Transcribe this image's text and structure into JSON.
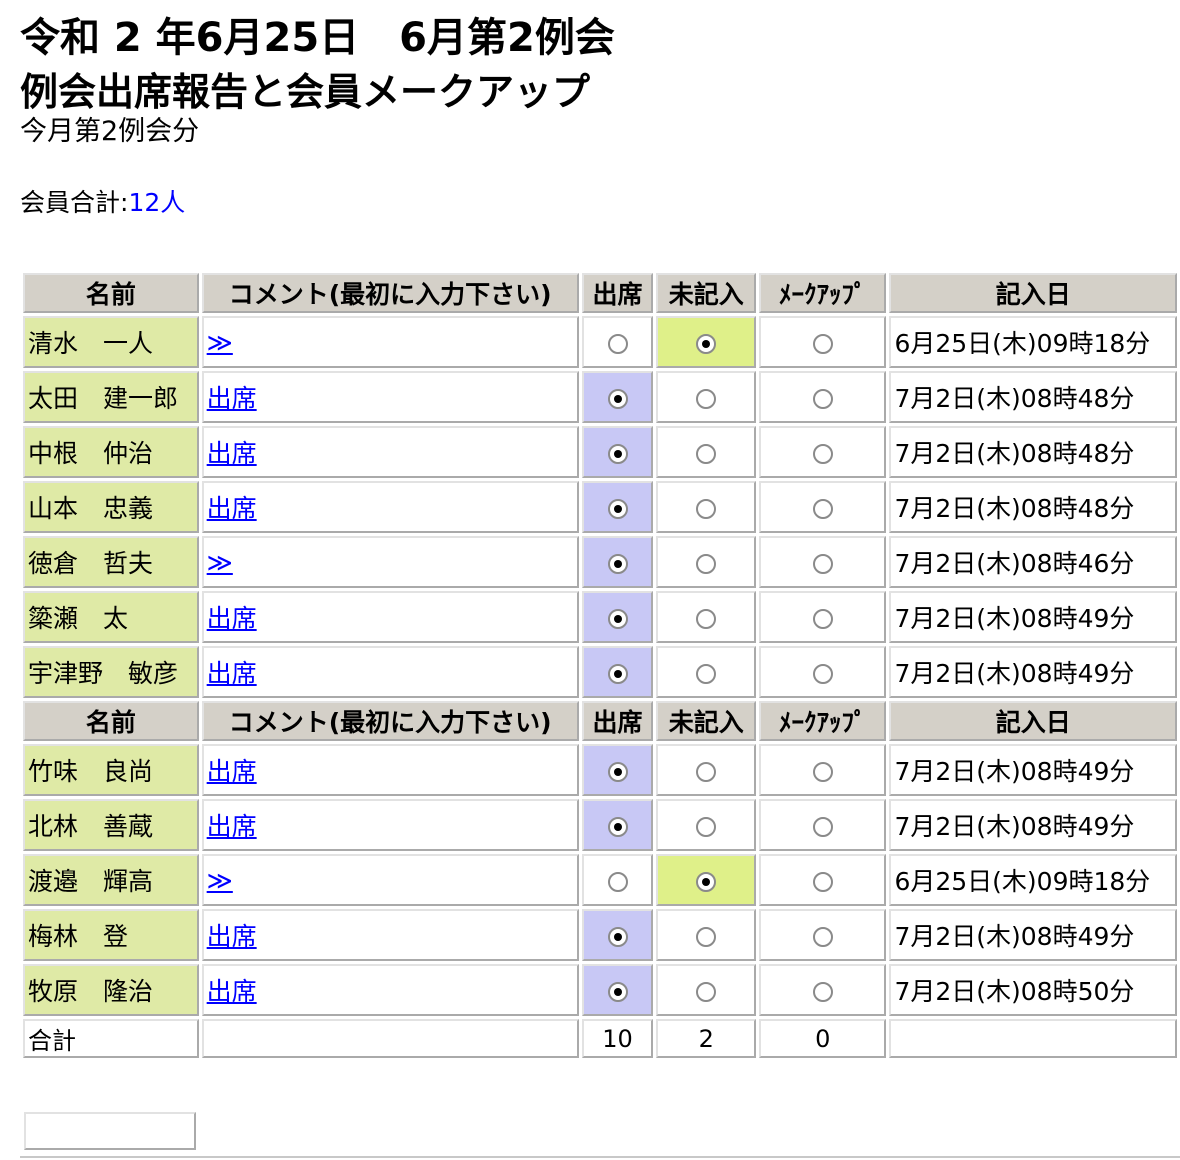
{
  "header": {
    "title": "令和 2 年6月25日　6月第2例会",
    "subtitle": "例会出席報告と会員メークアップ",
    "section": "今月第2例会分",
    "member_total_label": "会員合計:",
    "member_total_value": "12人"
  },
  "table": {
    "columns": [
      "名前",
      "コメント(最初に入力下さい)",
      "出席",
      "未記入",
      "ﾒｰｸｱｯﾌﾟ",
      "記入日"
    ],
    "rows": [
      {
        "name": "清水　一人",
        "comment": "≫",
        "status": "未記入",
        "date": "6月25日(木)09時18分"
      },
      {
        "name": "太田　建一郎",
        "comment": "出席",
        "status": "出席",
        "date": "7月2日(木)08時48分"
      },
      {
        "name": "中根　仲治",
        "comment": "出席",
        "status": "出席",
        "date": "7月2日(木)08時48分"
      },
      {
        "name": "山本　忠義",
        "comment": "出席",
        "status": "出席",
        "date": "7月2日(木)08時48分"
      },
      {
        "name": "徳倉　哲夫",
        "comment": "≫",
        "status": "出席",
        "date": "7月2日(木)08時46分"
      },
      {
        "name": "簗瀬　太",
        "comment": "出席",
        "status": "出席",
        "date": "7月2日(木)08時49分"
      },
      {
        "name": "宇津野　敏彦",
        "comment": "出席",
        "status": "出席",
        "date": "7月2日(木)08時49分"
      },
      {
        "name": "竹味　良尚",
        "comment": "出席",
        "status": "出席",
        "date": "7月2日(木)08時49分"
      },
      {
        "name": "北林　善蔵",
        "comment": "出席",
        "status": "出席",
        "date": "7月2日(木)08時49分"
      },
      {
        "name": "渡邉　輝高",
        "comment": "≫",
        "status": "未記入",
        "date": "6月25日(木)09時18分"
      },
      {
        "name": "梅林　登",
        "comment": "出席",
        "status": "出席",
        "date": "7月2日(木)08時49分"
      },
      {
        "name": "牧原　隆治",
        "comment": "出席",
        "status": "出席",
        "date": "7月2日(木)08時50分"
      }
    ],
    "totals": {
      "label": "合計",
      "attend": "10",
      "unentered": "2",
      "makeup": "0"
    }
  },
  "colors": {
    "name_bg": "#dfeaa6",
    "attend_selected_bg": "#c8c8f5",
    "unentered_selected_bg": "#dff089",
    "header_bg": "#d4d0c8",
    "link": "#0000ff"
  }
}
